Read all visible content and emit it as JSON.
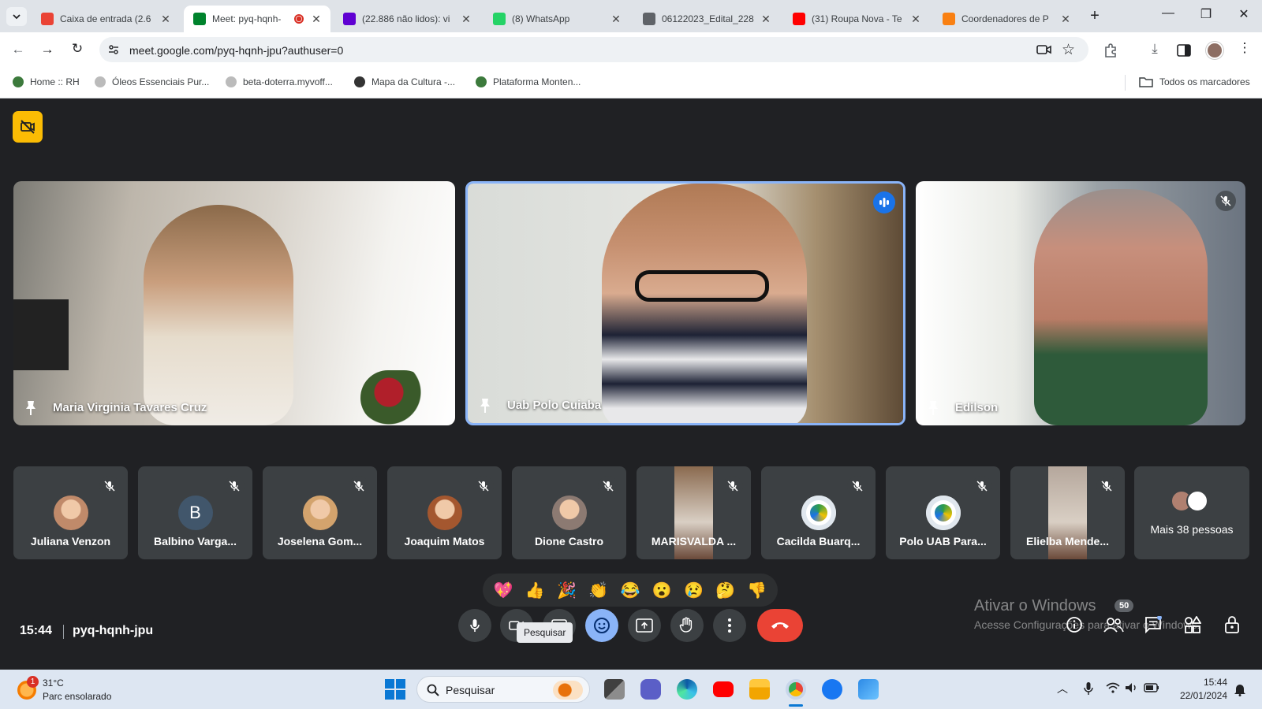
{
  "browser": {
    "tabs": [
      {
        "label": "Caixa de entrada (2.6",
        "favicon": "gmail-icon",
        "color": "#ea4335"
      },
      {
        "label": "Meet: pyq-hqnh-",
        "favicon": "meet-icon",
        "color": "#00832d",
        "active": true
      },
      {
        "label": "(22.886 não lidos): vi",
        "favicon": "yahoo-mail-icon",
        "color": "#6001d2"
      },
      {
        "label": "(8) WhatsApp",
        "favicon": "whatsapp-icon",
        "color": "#25d366"
      },
      {
        "label": "06122023_Edital_228",
        "favicon": "globe-icon",
        "color": "#5f6368"
      },
      {
        "label": "(31) Roupa Nova - Te",
        "favicon": "youtube-icon",
        "color": "#ff0000"
      },
      {
        "label": "Coordenadores de P",
        "favicon": "moodle-icon",
        "color": "#f98012"
      }
    ],
    "url": "meet.google.com/pyq-hqnh-jpu?authuser=0",
    "bookmarks": [
      {
        "label": "Home :: RH",
        "color": "#3c7a3c"
      },
      {
        "label": "Óleos Essenciais Pur...",
        "color": "#bbbbbb"
      },
      {
        "label": "beta-doterra.myvoff...",
        "color": "#bbbbbb"
      },
      {
        "label": "Mapa da Cultura -...",
        "color": "#333333"
      },
      {
        "label": "Plataforma Monten...",
        "color": "#3c7a3c"
      }
    ],
    "all_bookmarks": "Todos os marcadores"
  },
  "meet": {
    "main_tiles": [
      {
        "name": "Maria Virginia Tavares Cruz",
        "bg": "#c9bfb2"
      },
      {
        "name": "Uab Polo Cuiaba",
        "bg": "#7d7369",
        "speaking": true
      },
      {
        "name": "Edilson",
        "bg": "#a9a296",
        "muted": true
      }
    ],
    "participants": [
      {
        "name": "Juliana Venzon",
        "avatar": "photo",
        "color": "#c08a6a"
      },
      {
        "name": "Balbino Varga...",
        "avatar": "B",
        "color": "#41566b"
      },
      {
        "name": "Joselena Gom...",
        "avatar": "photo",
        "color": "#d3a36d"
      },
      {
        "name": "Joaquim Matos",
        "avatar": "photo",
        "color": "#a4572f"
      },
      {
        "name": "Dione Castro",
        "avatar": "photo",
        "color": "#8c7a72"
      },
      {
        "name": "MARISVALDA ...",
        "avatar": "video",
        "color": "#8a6a4f"
      },
      {
        "name": "Cacilda Buarq...",
        "avatar": "logo",
        "color": "#ffffff"
      },
      {
        "name": "Polo UAB Para...",
        "avatar": "logo",
        "color": "#ffffff"
      },
      {
        "name": "Elielba Mende...",
        "avatar": "video",
        "color": "#b5a79c"
      }
    ],
    "more_people": "Mais 38 pessoas",
    "reactions": [
      "💖",
      "👍",
      "🎉",
      "👏",
      "😂",
      "😮",
      "😢",
      "🤔",
      "👎"
    ],
    "time": "15:44",
    "meeting_code": "pyq-hqnh-jpu",
    "tooltip": "Pesquisar",
    "participant_count": "50",
    "windows_watermark": {
      "line1": "Ativar o Windows",
      "line2": "Acesse Configurações para ativar o Windows."
    }
  },
  "taskbar": {
    "weather_temp": "31°C",
    "weather_desc": "Parc ensolarado",
    "weather_badge": "1",
    "search_label": "Pesquisar",
    "time": "15:44",
    "date": "22/01/2024"
  },
  "colors": {
    "accent": "#1a73e8",
    "hangup": "#ea4335",
    "rec": "#fbbc04",
    "reaction_active": "#8ab4f8"
  }
}
